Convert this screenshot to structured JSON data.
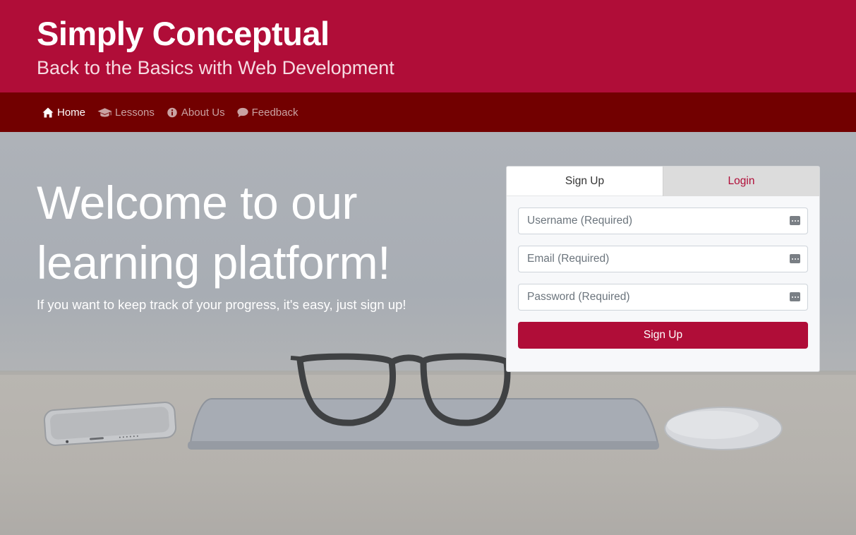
{
  "header": {
    "title": "Simply Conceptual",
    "subtitle": "Back to the Basics with Web Development"
  },
  "nav": {
    "items": [
      {
        "label": "Home",
        "icon": "home-icon",
        "active": true
      },
      {
        "label": "Lessons",
        "icon": "graduation-cap-icon",
        "active": false
      },
      {
        "label": "About Us",
        "icon": "info-icon",
        "active": false
      },
      {
        "label": "Feedback",
        "icon": "comment-icon",
        "active": false
      }
    ]
  },
  "hero": {
    "heading": "Welcome to our learning platform!",
    "text": "If you want to keep track of your progress, it's easy, just sign up!"
  },
  "auth": {
    "tabs": {
      "signup": "Sign Up",
      "login": "Login"
    },
    "fields": {
      "username": {
        "placeholder": "Username (Required)",
        "value": ""
      },
      "email": {
        "placeholder": "Email (Required)",
        "value": ""
      },
      "password": {
        "placeholder": "Password (Required)",
        "value": ""
      }
    },
    "submit_label": "Sign Up"
  },
  "colors": {
    "brand": "#b00d38",
    "nav_background": "#720000",
    "nav_text": "#c9a2a2",
    "nav_active_text": "#ffffff"
  }
}
